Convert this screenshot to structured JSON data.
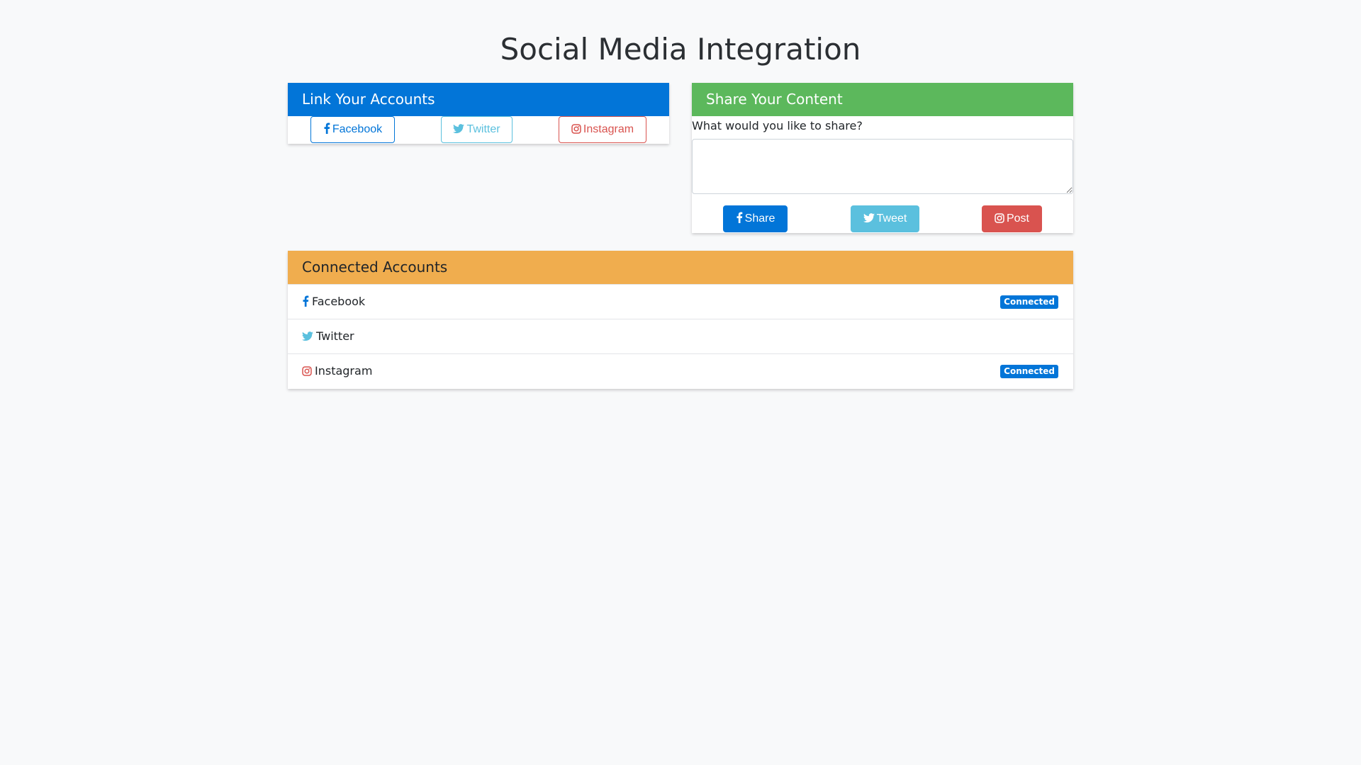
{
  "page": {
    "title": "Social Media Integration"
  },
  "link_card": {
    "header": "Link Your Accounts",
    "buttons": {
      "facebook": "Facebook",
      "twitter": "Twitter",
      "instagram": "Instagram"
    }
  },
  "share_card": {
    "header": "Share Your Content",
    "prompt": "What would you like to share?",
    "textarea_value": "",
    "buttons": {
      "share": "Share",
      "tweet": "Tweet",
      "post": "Post"
    }
  },
  "connected_card": {
    "header": "Connected Accounts",
    "accounts": [
      {
        "name": "Facebook",
        "icon": "facebook-icon",
        "status": "Connected"
      },
      {
        "name": "Twitter",
        "icon": "twitter-icon",
        "status": ""
      },
      {
        "name": "Instagram",
        "icon": "instagram-icon",
        "status": "Connected"
      }
    ]
  },
  "colors": {
    "primary": "#0275d8",
    "success": "#5cb85c",
    "warning": "#f0ad4e",
    "info": "#5bc0de",
    "danger": "#d9534f",
    "background": "#f8f9fa"
  }
}
